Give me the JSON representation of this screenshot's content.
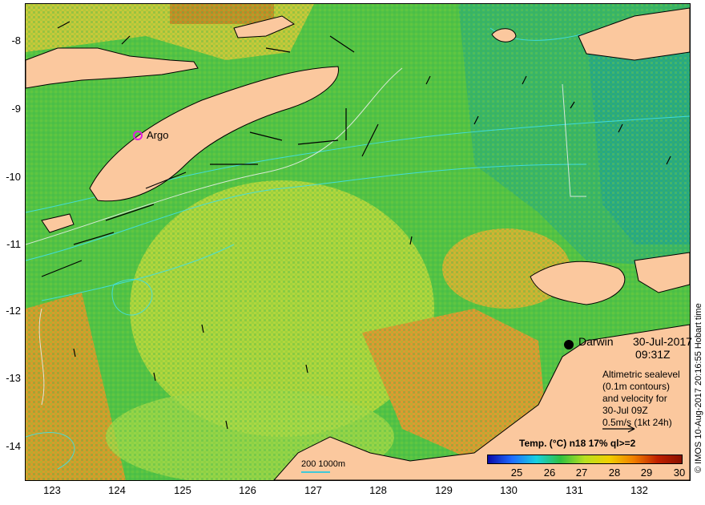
{
  "map": {
    "y_ticks": [
      "-8",
      "-9",
      "-10",
      "-11",
      "-12",
      "-13",
      "-14"
    ],
    "x_ticks": [
      "123",
      "124",
      "125",
      "126",
      "127",
      "128",
      "129",
      "130",
      "131",
      "132"
    ],
    "station_label": "Argo",
    "city_label": "Darwin",
    "date": "30-Jul-2017",
    "time": "09:31Z",
    "annotation_lines": [
      "Altimetric sealevel",
      "(0.1m contours)",
      "and velocity for",
      "30-Jul 09Z",
      "0.5m/s (1kt 24h)"
    ],
    "scale_bar_label": "200  1000m",
    "credit": "© IMOS 10-Aug-2017 20:16:55 Hobart time"
  },
  "legend": {
    "title": "Temp. (°C) n18 17% ql>=2",
    "ticks": [
      "25",
      "26",
      "27",
      "28",
      "29",
      "30"
    ],
    "colors": [
      "#0a0aa8",
      "#1e6cff",
      "#18d0e0",
      "#30c040",
      "#b8e020",
      "#f0d000",
      "#f08000",
      "#c02000",
      "#8a1000"
    ]
  },
  "colors": {
    "land": "#fbc89e",
    "sea_warm": "#e8a020",
    "sea_mid": "#a8d830",
    "sea_cool": "#30c050",
    "sea_cold": "#20b0a0",
    "contour": "#40e0e8"
  }
}
